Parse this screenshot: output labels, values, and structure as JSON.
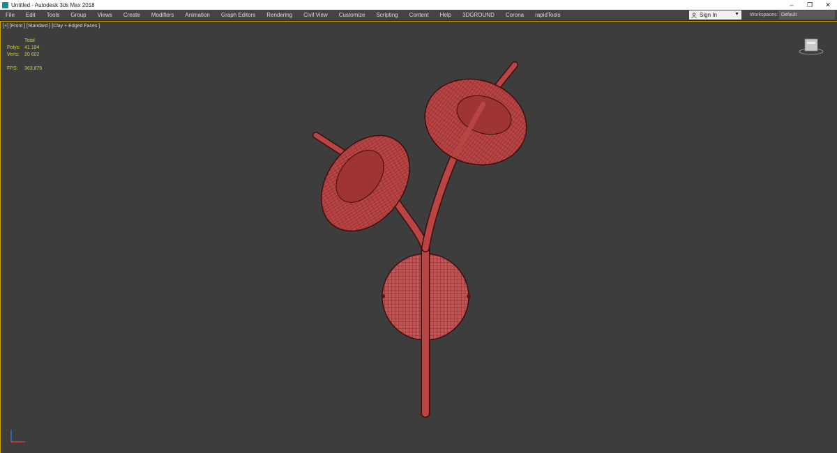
{
  "window": {
    "title": "Untitled - Autodesk 3ds Max 2018",
    "controls": [
      "–",
      "❐",
      "✕"
    ]
  },
  "menu": {
    "items": [
      "File",
      "Edit",
      "Tools",
      "Group",
      "Views",
      "Create",
      "Modifiers",
      "Animation",
      "Graph Editors",
      "Rendering",
      "Civil View",
      "Customize",
      "Scripting",
      "Content",
      "Help",
      "3DGROUND",
      "Corona",
      "rapidTools"
    ],
    "sign_in": "Sign In",
    "workspaces_label": "Workspaces:",
    "workspace_value": "Default"
  },
  "viewport": {
    "label": "[+] [Front ] [Standard ] [Clay + Edged Faces ]",
    "stats": {
      "header": "Total",
      "polys_label": "Polys:",
      "polys_value": "41 184",
      "verts_label": "Verts:",
      "verts_value": "20 602",
      "fps_label": "FPS:",
      "fps_value": "363,875"
    }
  },
  "colors": {
    "viewport_bg": "#3d3d3d",
    "active_border": "#caa400",
    "stats_text": "#e0d000",
    "model_fill": "#b84444",
    "model_wire": "#5a1414"
  }
}
